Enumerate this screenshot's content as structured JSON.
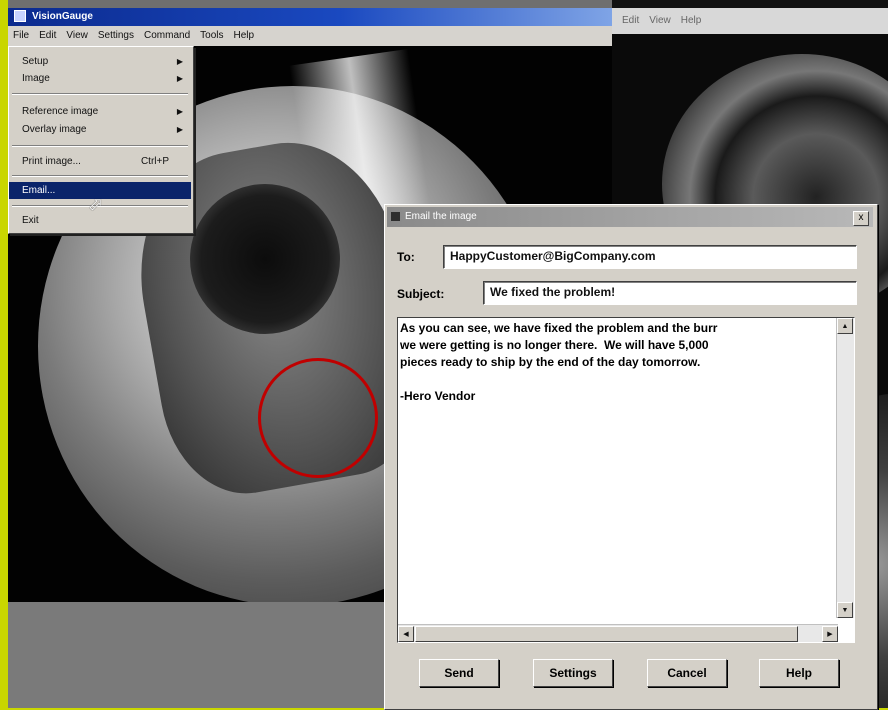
{
  "main_window": {
    "title": "VisionGauge",
    "menu": [
      "File",
      "Edit",
      "View",
      "Settings",
      "Command",
      "Tools",
      "Help"
    ]
  },
  "file_menu": {
    "items": [
      {
        "label": "Setup",
        "submenu": true
      },
      {
        "label": "Image",
        "submenu": true
      },
      {
        "label": "Reference image",
        "submenu": true
      },
      {
        "label": "Overlay image",
        "submenu": true
      },
      {
        "label": "Print image...",
        "shortcut": "Ctrl+P"
      },
      {
        "label": "Email...",
        "highlighted": true
      },
      {
        "label": "Exit"
      }
    ]
  },
  "second_window": {
    "menu": [
      "Edit",
      "View",
      "Help"
    ]
  },
  "email_dialog": {
    "title": "Email the image",
    "close_label": "x",
    "to_label": "To:",
    "to_value": "HappyCustomer@BigCompany.com",
    "subject_label": "Subject:",
    "subject_value": "We fixed the problem!",
    "body": "As you can see, we have fixed the problem and the burr\nwe were getting is no longer there.  We will have 5,000\npieces ready to ship by the end of the day tomorrow.\n\n-Hero Vendor",
    "buttons": {
      "send": "Send",
      "settings": "Settings",
      "cancel": "Cancel",
      "help": "Help"
    }
  },
  "colors": {
    "accent_title": "#0a246a",
    "defect_marker": "#c00000",
    "background": "#c9d600"
  },
  "icons": [
    "cursor-icon",
    "close-icon",
    "submenu-arrow-icon",
    "scroll-arrow-icon"
  ]
}
